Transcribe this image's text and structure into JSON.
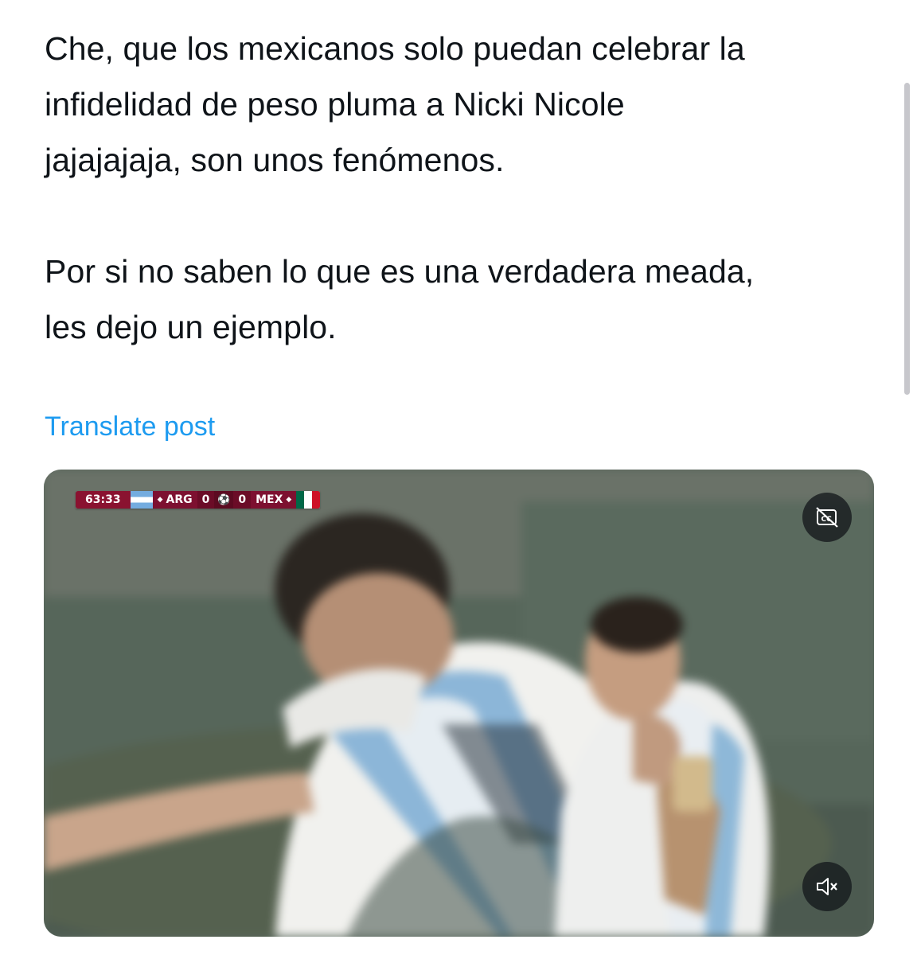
{
  "post": {
    "text": "Che, que los mexicanos solo puedan celebrar la\ninfidelidad de peso pluma a Nicki Nicole\njajajajaja, son unos fenómenos.\n\nPor si no saben lo que es una verdadera meada,\nles dejo un ejemplo.",
    "translate_label": "Translate post"
  },
  "video": {
    "scoreboard": {
      "clock": "63:33",
      "home_team": "ARG",
      "home_score": "0",
      "away_score": "0",
      "away_team": "MEX"
    },
    "controls": {
      "captions_icon": "captions-off-icon",
      "mute_icon": "muted-speaker-icon"
    }
  },
  "colors": {
    "text": "#0f1419",
    "link": "#1d9bf0",
    "scorebug": "#8a1230"
  }
}
